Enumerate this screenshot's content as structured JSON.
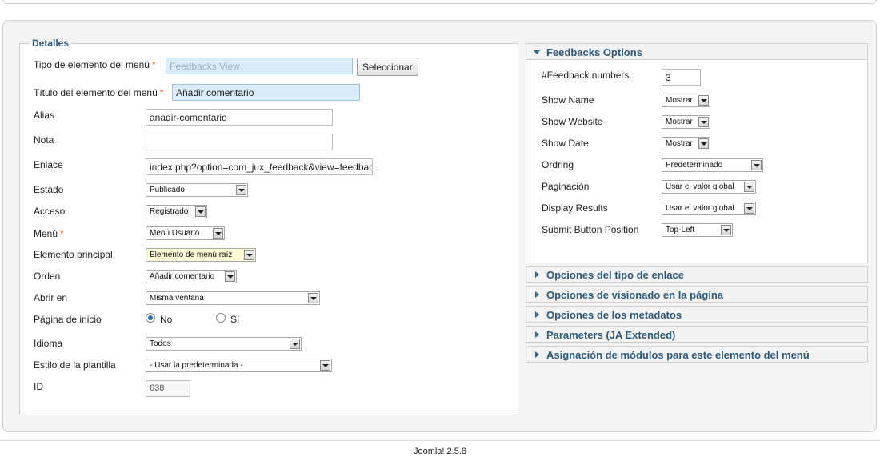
{
  "details": {
    "legend": "Detalles",
    "required_mark": "*",
    "menu_item_type": {
      "label": "Tipo de elemento del menú",
      "value": "Feedbacks View",
      "button": "Seleccionar"
    },
    "menu_title": {
      "label": "Título del elemento del menú",
      "value": "Añadir comentario"
    },
    "alias": {
      "label": "Alias",
      "value": "anadir-comentario"
    },
    "note": {
      "label": "Nota",
      "value": ""
    },
    "link": {
      "label": "Enlace",
      "value": "index.php?option=com_jux_feedback&view=feedbacks"
    },
    "status": {
      "label": "Estado",
      "value": "Publicado"
    },
    "access": {
      "label": "Acceso",
      "value": "Registrado"
    },
    "menu": {
      "label": "Menú",
      "value": "Menú Usuario"
    },
    "parent": {
      "label": "Elemento principal",
      "value": "Elemento de menú raíz"
    },
    "order": {
      "label": "Orden",
      "value": "Añadir comentario"
    },
    "open_in": {
      "label": "Abrir en",
      "value": "Misma ventana"
    },
    "home": {
      "label": "Página de inicio",
      "option_no": "No",
      "option_yes": "Sí",
      "selected": "No"
    },
    "language": {
      "label": "Idioma",
      "value": "Todos"
    },
    "template_style": {
      "label": "Estilo de la plantilla",
      "value": "- Usar la predeterminada -"
    },
    "id": {
      "label": "ID",
      "value": "638"
    }
  },
  "feedbacks_options": {
    "title": "Feedbacks Options",
    "expanded": true,
    "fields": {
      "feedback_numbers": {
        "label": "#Feedback numbers",
        "value": "3"
      },
      "show_name": {
        "label": "Show Name",
        "value": "Mostrar"
      },
      "show_website": {
        "label": "Show Website",
        "value": "Mostrar"
      },
      "show_date": {
        "label": "Show Date",
        "value": "Mostrar"
      },
      "ordering": {
        "label": "Ordring",
        "value": "Predeterminado"
      },
      "pagination": {
        "label": "Paginación",
        "value": "Usar el valor global"
      },
      "display_results": {
        "label": "Display Results",
        "value": "Usar el valor global"
      },
      "submit_position": {
        "label": "Submit Button Position",
        "value": "Top-Left"
      }
    }
  },
  "accordion": [
    {
      "label": "Opciones del tipo de enlace"
    },
    {
      "label": "Opciones de visionado en la página"
    },
    {
      "label": "Opciones de los metadatos"
    },
    {
      "label": "Parameters (JA Extended)"
    },
    {
      "label": "Asignación de módulos para este elemento del menú"
    }
  ],
  "footer": {
    "version": "Joomla! 2.5.8"
  },
  "colors": {
    "accent": "#2c5a7c",
    "required": "#e8672a",
    "highlight_input": "#d9ecf8"
  }
}
